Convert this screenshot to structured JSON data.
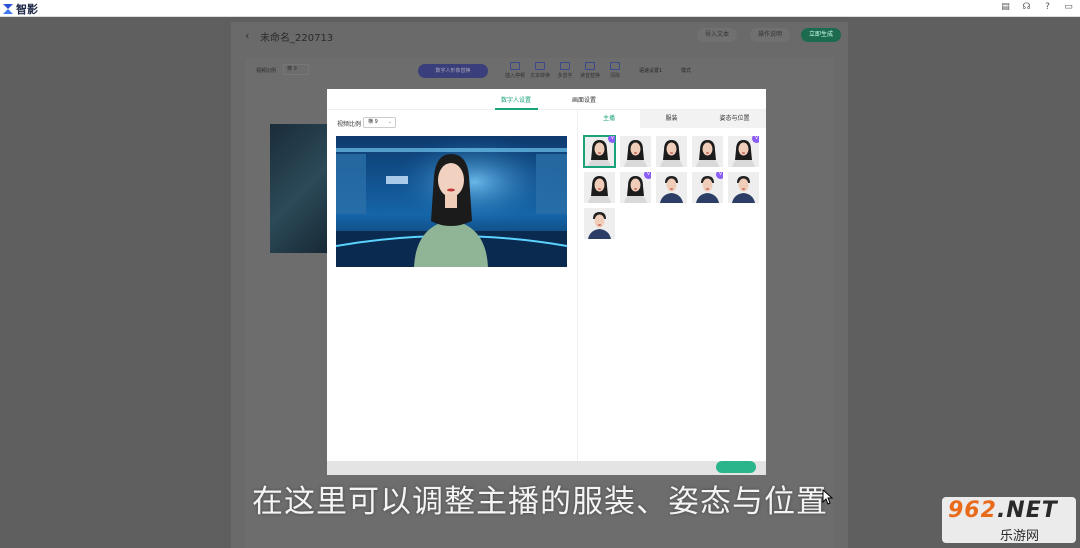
{
  "app": {
    "name": "智影"
  },
  "topbar_icons": [
    "doc-icon",
    "headset-icon",
    "help-icon",
    "message-icon"
  ],
  "editor": {
    "back_icon": "‹",
    "title": "未命名_220713",
    "buttons": [
      "导入文本",
      "操作说明",
      "立即生成"
    ],
    "ratio_label": "视频比例",
    "ratio_value": "横 9",
    "digital_human_button": "数字人形象替换",
    "tools": [
      "插入停顿",
      "文本转换",
      "多音字",
      "读音替换",
      "清除"
    ],
    "speed_label": "语速设置1",
    "mode_label": "模式"
  },
  "modal": {
    "tabs": [
      "数字人设置",
      "画面设置"
    ],
    "active_tab": 0,
    "video_ratio_label": "视频比例",
    "video_ratio_value": "横 9",
    "right_tabs": [
      "主播",
      "服装",
      "姿态与位置"
    ],
    "active_right_tab": 0,
    "avatars": [
      {
        "name": "female-anchor-1",
        "vip": true,
        "selected": true
      },
      {
        "name": "female-anchor-2",
        "vip": false,
        "selected": false
      },
      {
        "name": "female-anchor-3",
        "vip": false,
        "selected": false
      },
      {
        "name": "female-anchor-4",
        "vip": false,
        "selected": false
      },
      {
        "name": "female-anchor-5",
        "vip": true,
        "selected": false
      },
      {
        "name": "female-anchor-6",
        "vip": false,
        "selected": false
      },
      {
        "name": "female-anchor-7",
        "vip": true,
        "selected": false
      },
      {
        "name": "male-anchor-1",
        "vip": false,
        "selected": false
      },
      {
        "name": "male-anchor-2",
        "vip": true,
        "selected": false
      },
      {
        "name": "male-anchor-3",
        "vip": false,
        "selected": false
      },
      {
        "name": "male-anchor-4",
        "vip": false,
        "selected": false
      }
    ],
    "vip_badge": "V"
  },
  "subtitle": "在这里可以调整主播的服装、姿态与位置",
  "watermark": {
    "top": "962",
    "top_suffix": ".NET",
    "bottom": "乐游网"
  },
  "colors": {
    "accent": "#1aa27a",
    "vip": "#8b5cf6",
    "overlay": "#5f5f5f"
  }
}
